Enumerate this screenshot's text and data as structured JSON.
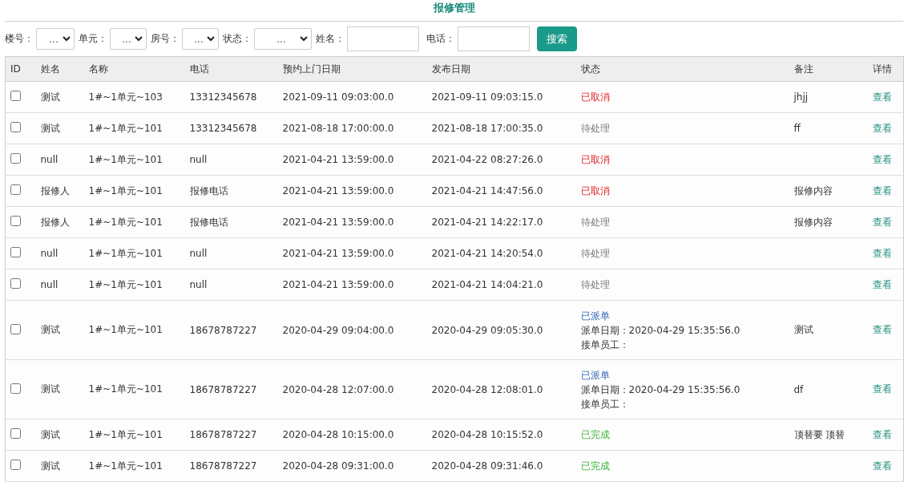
{
  "title": "报修管理",
  "filters": [
    {
      "kind": "select",
      "label": "楼号：",
      "value": "..."
    },
    {
      "kind": "select",
      "label": "单元：",
      "value": "..."
    },
    {
      "kind": "select",
      "label": "房号：",
      "value": "..."
    },
    {
      "kind": "select",
      "label": "状态：",
      "value": "..."
    },
    {
      "kind": "input",
      "label": "姓名："
    },
    {
      "kind": "input",
      "label": "电话："
    }
  ],
  "search_button": "搜索",
  "table": {
    "columns": [
      "ID",
      "姓名",
      "名称",
      "电话",
      "预约上门日期",
      "发布日期",
      "状态",
      "备注",
      "详情"
    ],
    "rows": [
      {
        "checked": false,
        "name": "测试",
        "title": "1#~1单元~103",
        "phone": "13312345678",
        "appointment": "2021-09-11 09:03:00.0",
        "published": "2021-09-11 09:03:15.0",
        "status": {
          "kind": "cancelled",
          "text": "已取消"
        },
        "remark": "jhjj",
        "detail": "查看"
      },
      {
        "checked": false,
        "name": "测试",
        "title": "1#~1单元~101",
        "phone": "13312345678",
        "appointment": "2021-08-18 17:00:00.0",
        "published": "2021-08-18 17:00:35.0",
        "status": {
          "kind": "pending",
          "text": "待处理"
        },
        "remark": "ff",
        "detail": "查看"
      },
      {
        "checked": false,
        "name": "null",
        "title": "1#~1单元~101",
        "phone": "null",
        "appointment": "2021-04-21 13:59:00.0",
        "published": "2021-04-22 08:27:26.0",
        "status": {
          "kind": "cancelled",
          "text": "已取消"
        },
        "detail": "查看"
      },
      {
        "checked": false,
        "name": "报修人",
        "title": "1#~1单元~101",
        "phone": "报修电话",
        "appointment": "2021-04-21 13:59:00.0",
        "published": "2021-04-21 14:47:56.0",
        "status": {
          "kind": "cancelled",
          "text": "已取消"
        },
        "remark": "报修内容",
        "detail": "查看"
      },
      {
        "checked": false,
        "name": "报修人",
        "title": "1#~1单元~101",
        "phone": "报修电话",
        "appointment": "2021-04-21 13:59:00.0",
        "published": "2021-04-21 14:22:17.0",
        "status": {
          "kind": "pending",
          "text": "待处理"
        },
        "remark": "报修内容",
        "detail": "查看"
      },
      {
        "checked": false,
        "name": "null",
        "title": "1#~1单元~101",
        "phone": "null",
        "appointment": "2021-04-21 13:59:00.0",
        "published": "2021-04-21 14:20:54.0",
        "status": {
          "kind": "pending",
          "text": "待处理"
        },
        "detail": "查看"
      },
      {
        "checked": false,
        "name": "null",
        "title": "1#~1单元~101",
        "phone": "null",
        "appointment": "2021-04-21 13:59:00.0",
        "published": "2021-04-21 14:04:21.0",
        "status": {
          "kind": "pending",
          "text": "待处理"
        },
        "detail": "查看"
      },
      {
        "checked": false,
        "name": "测试",
        "title": "1#~1单元~101",
        "phone": "18678787227",
        "appointment": "2020-04-29 09:04:00.0",
        "published": "2020-04-29 09:05:30.0",
        "status": {
          "kind": "dispatched",
          "text": "已派单",
          "dispatch_date": "派单日期：2020-04-29 15:35:56.0",
          "staff": "接单员工："
        },
        "remark": "测试",
        "detail": "查看"
      },
      {
        "checked": false,
        "name": "测试",
        "title": "1#~1单元~101",
        "phone": "18678787227",
        "appointment": "2020-04-28 12:07:00.0",
        "published": "2020-04-28 12:08:01.0",
        "status": {
          "kind": "dispatched",
          "text": "已派单",
          "dispatch_date": "派单日期：2020-04-29 15:35:56.0",
          "staff": "接单员工："
        },
        "remark": "df",
        "detail": "查看"
      },
      {
        "checked": false,
        "name": "测试",
        "title": "1#~1单元~101",
        "phone": "18678787227",
        "appointment": "2020-04-28 10:15:00.0",
        "published": "2020-04-28 10:15:52.0",
        "status": {
          "kind": "done",
          "text": "已完成"
        },
        "remark": "顶替要 顶替",
        "detail": "查看"
      },
      {
        "checked": false,
        "name": "测试",
        "title": "1#~1单元~101",
        "phone": "18678787227",
        "appointment": "2020-04-28 09:31:00.0",
        "published": "2020-04-28 09:31:46.0",
        "status": {
          "kind": "done",
          "text": "已完成"
        },
        "detail": "查看"
      }
    ]
  }
}
